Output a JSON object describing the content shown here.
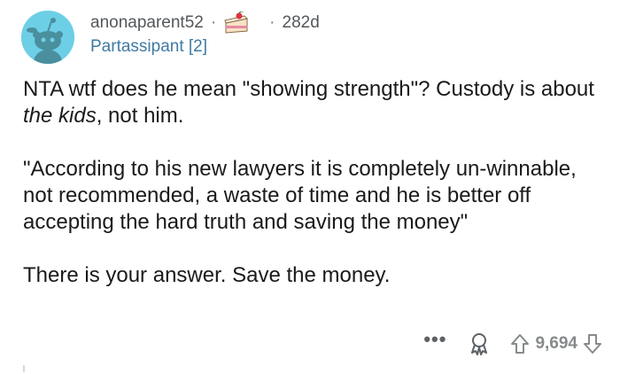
{
  "comment": {
    "author": "anonaparent52",
    "separator": "·",
    "age": "282d",
    "flair": "Partassipant [2]",
    "flair_icon": "cake-icon",
    "paragraphs": [
      {
        "prefix": "NTA wtf does he mean \"showing strength\"? Custody is about ",
        "emphasis": "the kids",
        "suffix": ", not him."
      },
      {
        "text": "\"According to his new lawyers it is completely un-winnable, not recommended, a waste of time and he is better off accepting the hard truth and saving the money\""
      },
      {
        "text": "There is your answer. Save the money."
      }
    ],
    "actions": {
      "more": "•••",
      "award_icon": "award-icon",
      "upvote_icon": "upvote-icon",
      "score": "9,694",
      "downvote_icon": "downvote-icon"
    }
  },
  "colors": {
    "avatar_bg": "#6dcfe6",
    "flair_text": "#3f7aa3",
    "meta_text": "#53575b",
    "action_gray": "#878a8c"
  }
}
